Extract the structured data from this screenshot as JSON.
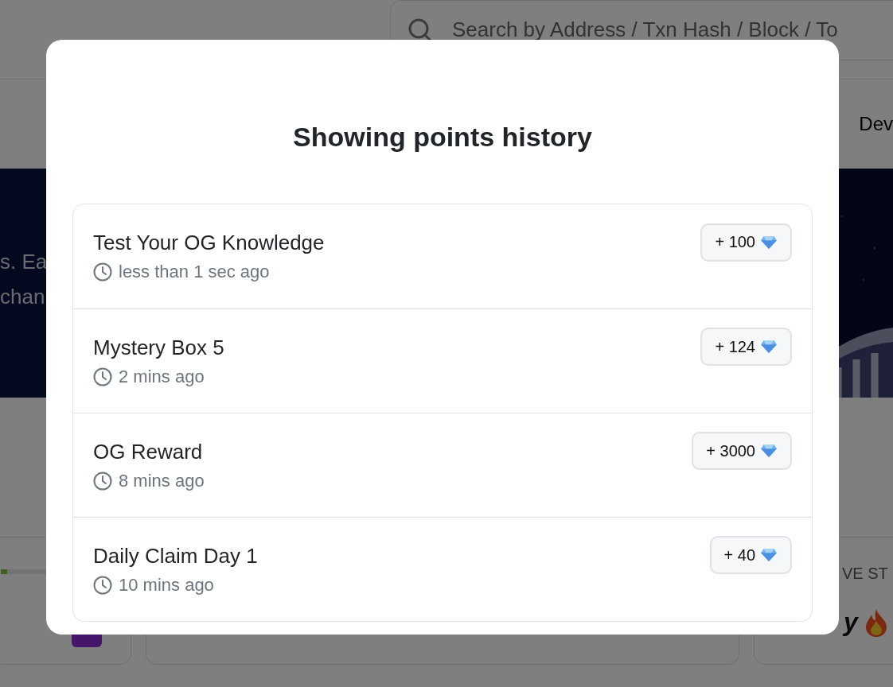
{
  "header": {
    "search": {
      "placeholder": "Search by Address / Txn Hash / Block / To"
    }
  },
  "nav": {
    "items": [
      "Dev"
    ]
  },
  "banner": {
    "lines": [
      "s. Ea",
      "chan"
    ],
    "image": {
      "kind": "picture"
    }
  },
  "cards": [
    {
      "kind": "progress",
      "level": 0.05
    },
    {
      "kind": "empty"
    },
    {
      "kind": "streak",
      "label": "VE ST",
      "value": "y"
    }
  ],
  "modal": {
    "title": "Showing points history",
    "items": [
      {
        "title": "Test Your OG Knowledge",
        "time": "less than 1 sec ago",
        "points": "+ 100"
      },
      {
        "title": "Mystery Box 5",
        "time": "2 mins ago",
        "points": "+ 124"
      },
      {
        "title": "OG Reward",
        "time": "8 mins ago",
        "points": "+ 3000"
      },
      {
        "title": "Daily Claim Day 1",
        "time": "10 mins ago",
        "points": "+ 40"
      }
    ]
  }
}
